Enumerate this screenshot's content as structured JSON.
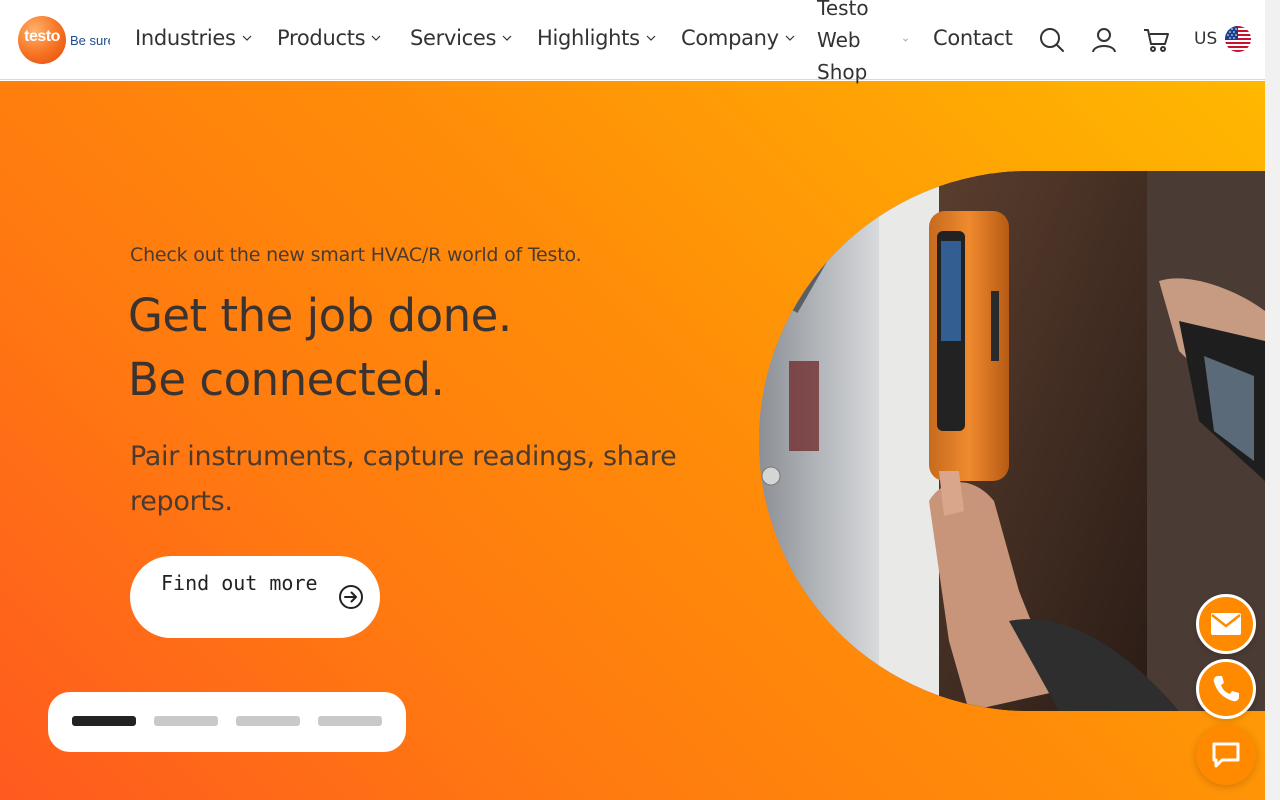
{
  "header": {
    "logo_word": "testo",
    "logo_tagline": "Be sure.",
    "nav": [
      {
        "label": "Industries"
      },
      {
        "label": "Products"
      },
      {
        "label": "Services"
      },
      {
        "label": "Highlights"
      },
      {
        "label": "Company"
      }
    ],
    "webshop_label": "Testo Web Shop",
    "contact_label": "Contact",
    "icons": [
      "search-icon",
      "user-icon",
      "cart-icon"
    ],
    "locale_code": "US",
    "locale_flag": "us-flag-icon"
  },
  "hero": {
    "kicker": "Check out the new smart HVAC/R world of Testo.",
    "headline_line1": "Get the job done.",
    "headline_line2": "Be connected.",
    "subline": "Pair instruments, capture readings, share reports.",
    "cta_label": "Find out more",
    "cta_icon": "arrow-circle-right-icon"
  },
  "floating_actions": [
    "mail-icon",
    "phone-icon",
    "chat-icon"
  ],
  "colors": {
    "brand_orange": "#ff8a00",
    "gradient_start": "#ff5a1f",
    "gradient_end": "#ffb800",
    "text_dark": "#3b3330"
  }
}
